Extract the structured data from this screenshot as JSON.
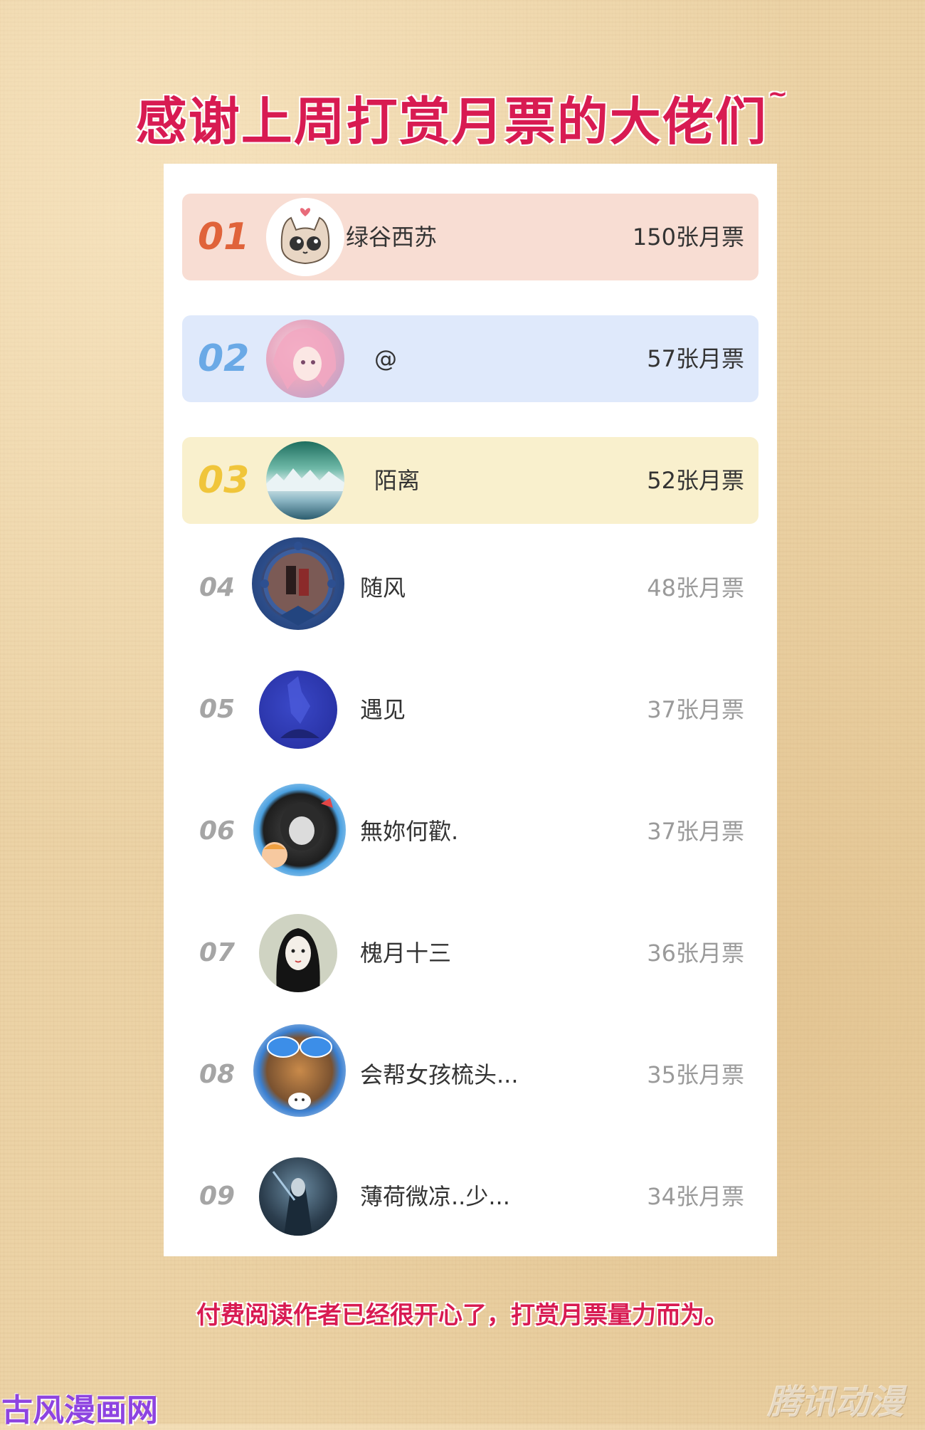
{
  "title": "感谢上周打赏月票的大佬们",
  "title_tilde": "~",
  "colors": {
    "title": "#d81b52",
    "rank1_bg": "#f8ddd3",
    "rank1_text": "#e0633a",
    "rank2_bg": "#dfe9fb",
    "rank2_text": "#6aa9e6",
    "rank3_bg": "#f9f0cd",
    "rank3_text": "#f0c53a",
    "rank_other_text": "#a5a5a5"
  },
  "leaderboard": [
    {
      "rank": "01",
      "name": "绿谷西苏",
      "votes": "150张月票",
      "avatar": "cat-avatar"
    },
    {
      "rank": "02",
      "name": "@",
      "votes": "57张月票",
      "avatar": "pink-hair-anime-avatar"
    },
    {
      "rank": "03",
      "name": "陌离",
      "votes": "52张月票",
      "avatar": "aurora-landscape-avatar"
    },
    {
      "rank": "04",
      "name": "随风",
      "votes": "48张月票",
      "avatar": "framed-figures-avatar"
    },
    {
      "rank": "05",
      "name": "遇见",
      "votes": "37张月票",
      "avatar": "blue-figure-avatar"
    },
    {
      "rank": "06",
      "name": "無妳何歡.",
      "votes": "37张月票",
      "avatar": "dark-hair-boy-avatar"
    },
    {
      "rank": "07",
      "name": "槐月十三",
      "votes": "36张月票",
      "avatar": "girl-portrait-avatar"
    },
    {
      "rank": "08",
      "name": "会帮女孩梳头...",
      "votes": "35张月票",
      "avatar": "sunglasses-frame-avatar"
    },
    {
      "rank": "09",
      "name": "薄荷微凉..少...",
      "votes": "34张月票",
      "avatar": "dark-warrior-avatar"
    }
  ],
  "footer": "付费阅读作者已经很开心了，打赏月票量力而为。",
  "watermark_left": "古风漫画网",
  "watermark_right": "腾讯动漫"
}
